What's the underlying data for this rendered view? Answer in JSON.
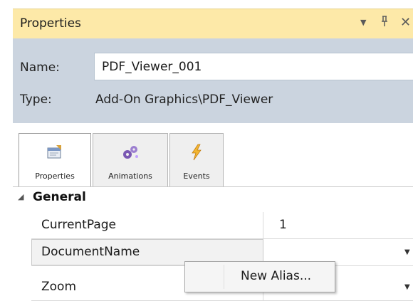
{
  "window": {
    "title": "Properties",
    "controls": [
      "dropdown-icon",
      "pin-icon",
      "close-icon"
    ]
  },
  "header": {
    "name_label": "Name:",
    "name_value": "PDF_Viewer_001",
    "type_label": "Type:",
    "type_value": "Add-On Graphics\\PDF_Viewer"
  },
  "tabs": [
    {
      "label": "Properties",
      "icon": "properties-icon",
      "active": true
    },
    {
      "label": "Animations",
      "icon": "animations-icon",
      "active": false
    },
    {
      "label": "Events",
      "icon": "events-icon",
      "active": false
    }
  ],
  "grid": {
    "category": "General",
    "rows": [
      {
        "name": "CurrentPage",
        "value": "1"
      },
      {
        "name": "DocumentName",
        "value": ""
      },
      {
        "name": "Zoom",
        "value": ""
      }
    ]
  },
  "context_menu": {
    "items": [
      "New Alias..."
    ]
  },
  "colors": {
    "titlebar": "#fde9a8",
    "header": "#cbd4df"
  }
}
